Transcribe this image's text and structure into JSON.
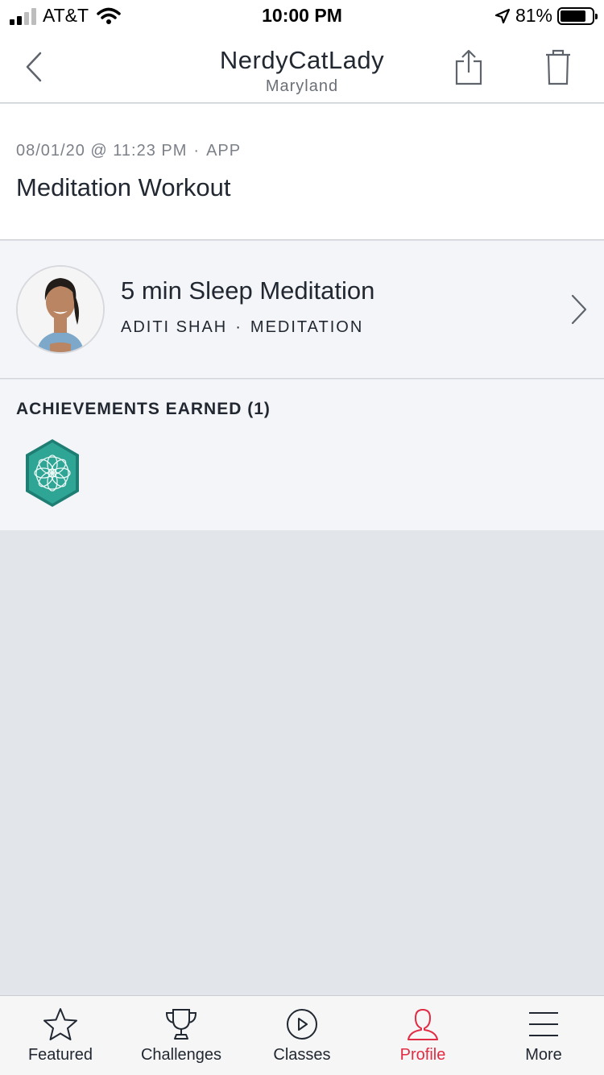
{
  "status": {
    "carrier": "AT&T",
    "time": "10:00 PM",
    "battery_pct": "81%",
    "battery_level": 0.81
  },
  "nav": {
    "title": "NerdyCatLady",
    "subtitle": "Maryland",
    "back_icon": "chevron-left-icon",
    "share_icon": "share-icon",
    "delete_icon": "trash-icon"
  },
  "workout": {
    "datetime": "08/01/20 @ 11:23 PM",
    "separator": "·",
    "source": "APP",
    "title": "Meditation Workout"
  },
  "class": {
    "title": "5 min Sleep Meditation",
    "instructor": "ADITI SHAH",
    "separator": "·",
    "category": "MEDITATION"
  },
  "achievements": {
    "title": "ACHIEVEMENTS EARNED (1)",
    "badge_color": "#2a9a8a"
  },
  "tabs": [
    {
      "label": "Featured",
      "icon": "star-icon",
      "active": false
    },
    {
      "label": "Challenges",
      "icon": "trophy-icon",
      "active": false
    },
    {
      "label": "Classes",
      "icon": "play-circle-icon",
      "active": false
    },
    {
      "label": "Profile",
      "icon": "profile-icon",
      "active": true
    },
    {
      "label": "More",
      "icon": "menu-icon",
      "active": false
    }
  ],
  "colors": {
    "accent": "#e12c43",
    "text": "#222831"
  }
}
